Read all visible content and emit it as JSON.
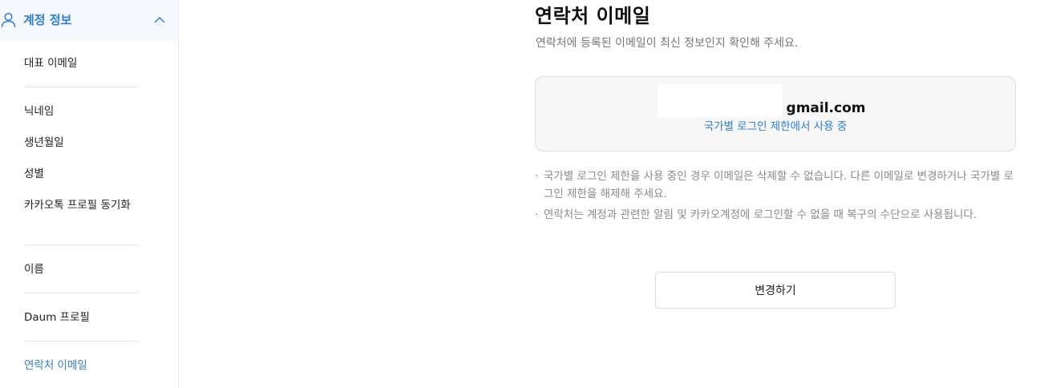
{
  "sidebar": {
    "section_title": "계정 정보",
    "section_icon": "user-icon",
    "collapse_icon": "chevron-up-icon",
    "accent_color": "#2f80d4",
    "items": [
      {
        "label": "대표 이메일"
      },
      {
        "label": "닉네임"
      },
      {
        "label": "생년월일"
      },
      {
        "label": "성별"
      },
      {
        "label": "카카오톡 프로필 동기화"
      },
      {
        "label": "이름"
      },
      {
        "label": "Daum 프로필"
      },
      {
        "label": "연락처 이메일",
        "active": true
      }
    ]
  },
  "main": {
    "title": "연락처 이메일",
    "description": "연락처에 등록된 이메일이 최신 정보인지 확인해 주세요.",
    "email": {
      "value": "gmail.com",
      "status": "국가별 로그인 제한에서 사용 중"
    },
    "notes": [
      "국가별 로그인 제한을 사용 중인 경우 이메일은 삭제할 수 없습니다. 다른 이메일로 변경하거나 국가별 로그인 제한을 해제해 주세요.",
      "연락처는 계정과 관련한 알림 및 카카오계정에 로그인할 수 없을 때 복구의 수단으로 사용됩니다."
    ],
    "bullet": "·",
    "change_button": "변경하기"
  }
}
